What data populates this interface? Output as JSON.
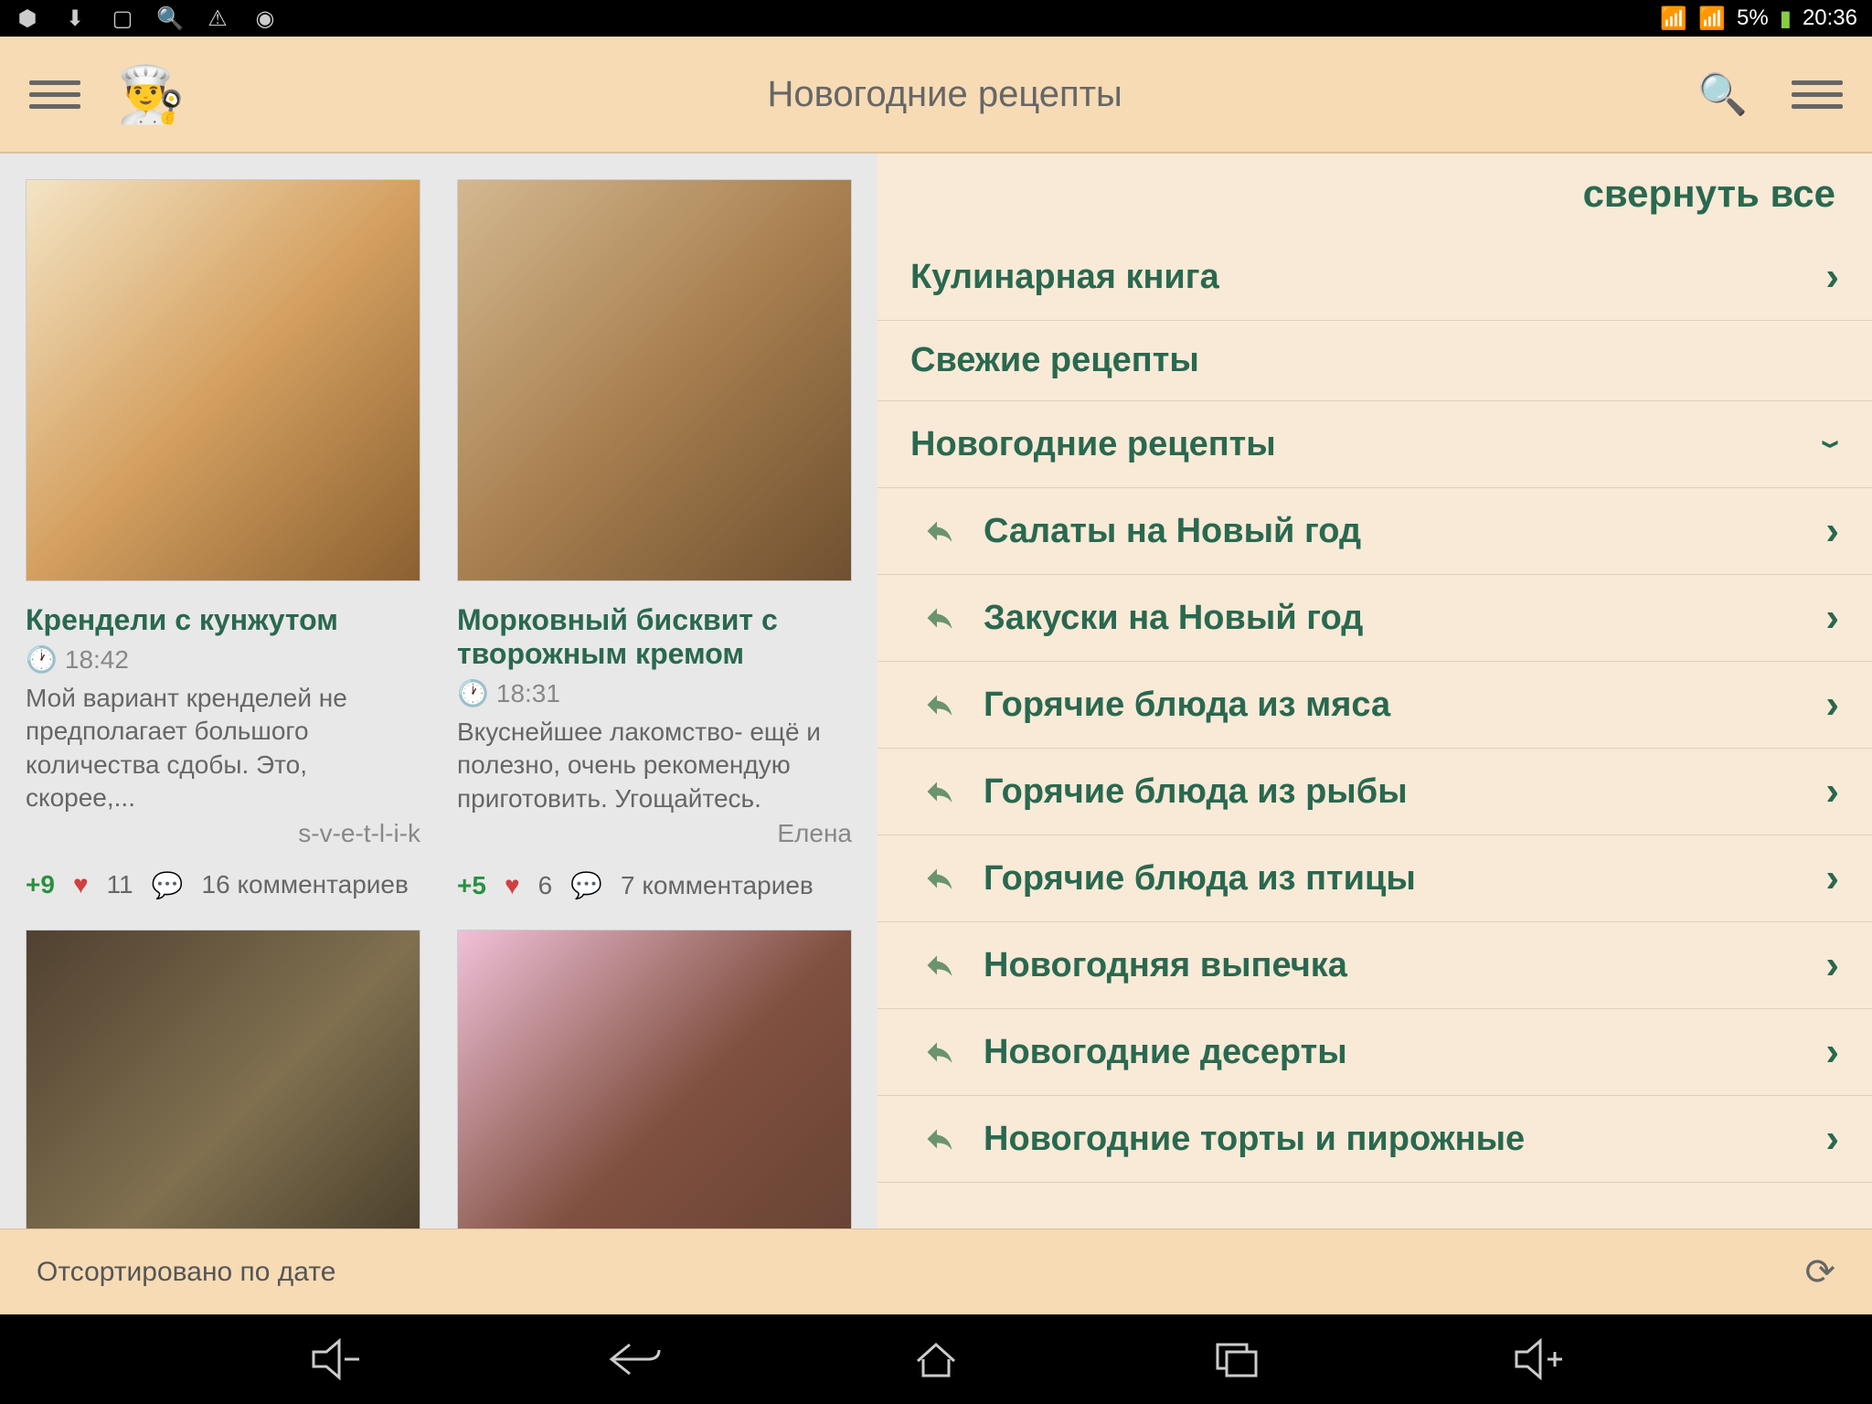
{
  "status_bar": {
    "battery_pct": "5%",
    "time": "20:36"
  },
  "header": {
    "title": "Новогодние рецепты"
  },
  "recipes": [
    {
      "title": "Крендели с кунжутом",
      "time": "18:42",
      "desc": "Мой вариант кренделей не предполагает большого количества сдобы. Это, скорее,...",
      "author": "s-v-e-t-l-i-k",
      "rating": "+9",
      "likes": "11",
      "comments": "16 комментариев"
    },
    {
      "title": "Морковный бисквит с творожным кремом",
      "time": "18:31",
      "desc": "Вкуснейшее лакомство- ещё и полезно, очень рекомендую приготовить. Угощайтесь.",
      "author": "Елена",
      "rating": "+5",
      "likes": "6",
      "comments": "7 комментариев"
    }
  ],
  "sidebar": {
    "collapse_all": "свернуть все",
    "categories": [
      {
        "label": "Кулинарная книга",
        "sub": false,
        "expanded": false
      },
      {
        "label": "Свежие рецепты",
        "sub": false,
        "expanded": null
      },
      {
        "label": "Новогодние рецепты",
        "sub": false,
        "expanded": true
      },
      {
        "label": "Салаты на Новый год",
        "sub": true
      },
      {
        "label": "Закуски на Новый год",
        "sub": true
      },
      {
        "label": "Горячие блюда из мяса",
        "sub": true
      },
      {
        "label": "Горячие блюда из рыбы",
        "sub": true
      },
      {
        "label": "Горячие блюда из птицы",
        "sub": true
      },
      {
        "label": "Новогодняя выпечка",
        "sub": true
      },
      {
        "label": "Новогодние десерты",
        "sub": true
      },
      {
        "label": "Новогодние торты и пирожные",
        "sub": true
      }
    ]
  },
  "bottom_bar": {
    "sort_label": "Отсортировано по дате"
  }
}
